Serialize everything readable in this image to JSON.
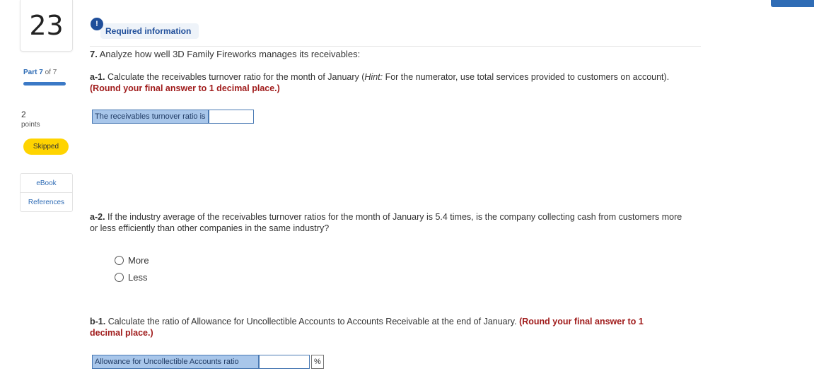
{
  "question": {
    "number": "23",
    "part_strong": "Part 7",
    "part_rest": " of 7",
    "progress_fraction": 1.0,
    "points_value": "2",
    "points_label": "points",
    "status_badge": "Skipped",
    "links": [
      "eBook",
      "References"
    ]
  },
  "header": {
    "alert_icon_glyph": "!",
    "required_text": "Required information"
  },
  "content": {
    "title_number": "7.",
    "title_text": " Analyze how well 3D Family Fireworks manages its receivables:",
    "a1": {
      "label": "a-1.",
      "text": " Calculate the receivables turnover ratio for the month of January (",
      "hint_italic": "Hint:",
      "hint_text": " For the numerator, use total services provided to customers on account). ",
      "instruction": "(Round your final answer to 1 decimal place.)",
      "answer_label": "The receivables turnover ratio is",
      "answer_value": ""
    },
    "a2": {
      "label": "a-2.",
      "text": " If the industry average of the receivables turnover ratios for the month of January is 5.4 times, is the company collecting cash from customers more or less efficiently than other companies in the same industry?",
      "options": [
        "More",
        "Less"
      ]
    },
    "b1": {
      "label": "b-1.",
      "text": " Calculate the ratio of Allowance for Uncollectible Accounts to Accounts Receivable at the end of January. ",
      "instruction": "(Round your final answer to 1 decimal place.)",
      "answer_label": "Allowance for Uncollectible Accounts ratio",
      "answer_value": "",
      "unit": "%"
    }
  },
  "colors": {
    "accent": "#2f6cb5",
    "instruction_red": "#a01c1c",
    "badge_yellow": "#ffd400",
    "answer_label_bg": "#a8c6ea"
  }
}
